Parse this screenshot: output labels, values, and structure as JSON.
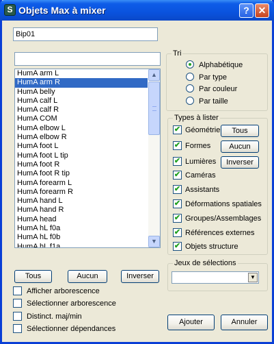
{
  "window": {
    "title": "Objets Max à mixer",
    "help_label": "?",
    "close_label": "✕"
  },
  "name_field": {
    "value": "Bip01"
  },
  "search_field": {
    "value": ""
  },
  "list": {
    "items": [
      "HumA arm L",
      "HumA arm R",
      "HumA belly",
      "HumA calf L",
      "HumA calf R",
      "HumA COM",
      "HumA elbow L",
      "HumA elbow R",
      "HumA foot L",
      "HumA foot L tip",
      "HumA foot R",
      "HumA foot R tip",
      "HumA forearm L",
      "HumA forearm R",
      "HumA hand L",
      "HumA hand R",
      "HumA head",
      "HumA hL f0a",
      "HumA hL f0b",
      "HumA hL f1a"
    ],
    "selected_index": 1
  },
  "list_buttons": {
    "all": "Tous",
    "none": "Aucun",
    "invert": "Inverser"
  },
  "options": [
    {
      "label": "Afficher arborescence",
      "checked": false
    },
    {
      "label": "Sélectionner arborescence",
      "checked": false
    },
    {
      "label": "Distinct. maj/min",
      "checked": false
    },
    {
      "label": "Sélectionner dépendances",
      "checked": false
    }
  ],
  "sort_group": {
    "title": "Tri",
    "options": [
      "Alphabétique",
      "Par type",
      "Par couleur",
      "Par taille"
    ],
    "selected": "Alphabétique"
  },
  "types_group": {
    "title": "Types à lister",
    "items": [
      {
        "label": "Géométrie",
        "checked": true
      },
      {
        "label": "Formes",
        "checked": true
      },
      {
        "label": "Lumières",
        "checked": true
      },
      {
        "label": "Caméras",
        "checked": true
      },
      {
        "label": "Assistants",
        "checked": true
      },
      {
        "label": "Déformations spatiales",
        "checked": true
      },
      {
        "label": "Groupes/Assemblages",
        "checked": true
      },
      {
        "label": "Références externes",
        "checked": true
      },
      {
        "label": "Objets structure",
        "checked": true
      }
    ],
    "buttons": {
      "all": "Tous",
      "none": "Aucun",
      "invert": "Inverser"
    }
  },
  "selection_sets": {
    "title": "Jeux de sélections",
    "value": ""
  },
  "dialog_buttons": {
    "ok": "Ajouter",
    "cancel": "Annuler"
  },
  "colors": {
    "titlebar": "#0a53de",
    "selection": "#316ac5",
    "face": "#ece9d8",
    "check": "#21a121"
  }
}
